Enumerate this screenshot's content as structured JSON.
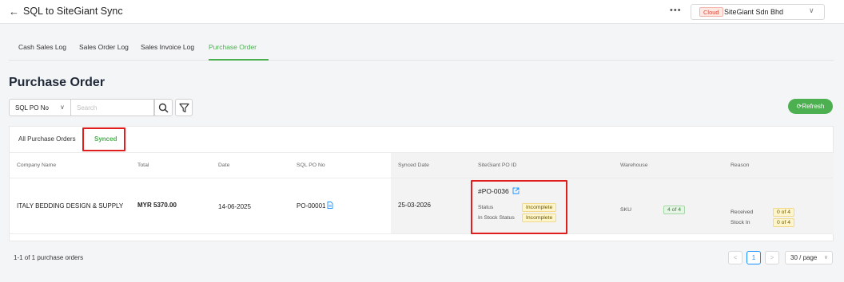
{
  "header": {
    "back_icon": "arrow-left-icon",
    "back_glyph": "←",
    "title": "SQL to SiteGiant Sync",
    "more_glyph": "•••",
    "cloud_badge": "Cloud",
    "company": "SiteGiant Sdn Bhd",
    "chevron_glyph": "∨"
  },
  "tabs": [
    {
      "label": "Cash Sales Log",
      "active": false
    },
    {
      "label": "Sales Order Log",
      "active": false
    },
    {
      "label": "Sales Invoice Log",
      "active": false
    },
    {
      "label": "Purchase Order",
      "active": true
    }
  ],
  "page_title": "Purchase Order",
  "search": {
    "field": "SQL PO No",
    "chevron_glyph": "∨",
    "placeholder": "Search",
    "search_icon": "search-icon",
    "filter_icon": "filter-icon"
  },
  "refresh_button": {
    "icon": "refresh-icon",
    "glyph": "⟳",
    "label": "Refresh"
  },
  "subtabs": [
    {
      "label": "All Purchase Orders",
      "active": false
    },
    {
      "label": "Synced",
      "active": true
    }
  ],
  "table": {
    "columns": [
      "Company Name",
      "Total",
      "Date",
      "SQL PO No",
      "Synced Date",
      "SiteGiant PO ID",
      "Warehouse",
      "Reason"
    ],
    "rows": [
      {
        "company_name": "ITALY BEDDING DESIGN & SUPPLY",
        "total": "MYR 5370.00",
        "date": "14-06-2025",
        "sql_po_no": "PO-00001",
        "synced_date": "25-03-2026",
        "sitegiant_po_id": "#PO-0036",
        "status_label": "Status",
        "status_value": "Incomplete",
        "stock_label": "In Stock Status",
        "stock_value": "Incomplete",
        "warehouse_label": "SKU",
        "warehouse_value": "4 of 4",
        "received_label": "Received",
        "received_value": "0 of 4",
        "stock_in_label": "Stock In",
        "stock_in_value": "0 of 4"
      }
    ]
  },
  "colors": {
    "accent": "#4caf50",
    "highlight": "#e01e1e",
    "pagination_active": "#1890ff"
  },
  "footer": {
    "count_text": "1-1 of 1 purchase orders",
    "prev_glyph": "<",
    "current_page": "1",
    "next_glyph": ">",
    "page_size": "30 / page",
    "chevron_glyph": "∨"
  }
}
